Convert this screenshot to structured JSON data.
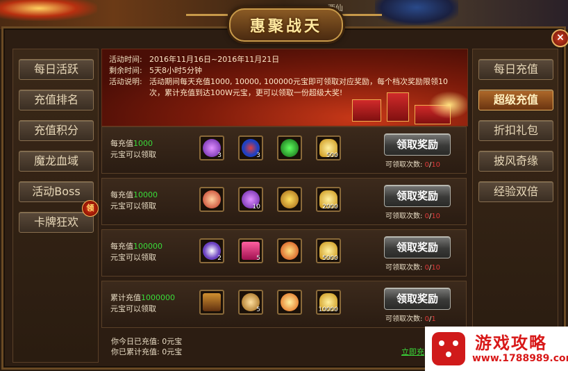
{
  "window": {
    "title": "惠聚战天",
    "top_name": "酉仙",
    "close_label": "×"
  },
  "left_menu": [
    {
      "label": "每日活跃"
    },
    {
      "label": "充值排名"
    },
    {
      "label": "充值积分"
    },
    {
      "label": "魔龙血域"
    },
    {
      "label": "活动Boss"
    },
    {
      "label": "卡牌狂欢"
    }
  ],
  "claim_badge": "领",
  "right_menu": [
    {
      "label": "每日充值",
      "active": false
    },
    {
      "label": "超级充值",
      "active": true
    },
    {
      "label": "折扣礼包",
      "active": false
    },
    {
      "label": "披风奇缘",
      "active": false
    },
    {
      "label": "经验双倍",
      "active": false
    }
  ],
  "banner": {
    "time_label": "活动时间:",
    "time_value": "2016年11月16日~2016年11月21日",
    "remain_label": "剩余时间:",
    "remain_value": "5天8小时5分钟",
    "desc_label": "活动说明:",
    "desc_line1": "活动期间每天充值1000, 10000, 100000元宝即可领取对应奖励，每个档次奖励限领10",
    "desc_line2": "次，累计充值到达100W元宝，更可以领取一份超级大奖!"
  },
  "tiers": [
    {
      "prefix": "每充值",
      "amount": "1000",
      "suffix": "元宝可以领取",
      "items": [
        {
          "icon": "purple-gem-icon",
          "qty": "3"
        },
        {
          "icon": "blue-orb-icon",
          "qty": "3"
        },
        {
          "icon": "green-rune-icon",
          "qty": ""
        },
        {
          "icon": "gold-ingot-icon",
          "qty": "500"
        }
      ],
      "button": "领取奖励",
      "count_label": "可领取次数:",
      "count_used": "0",
      "count_max": "10"
    },
    {
      "prefix": "每充值",
      "amount": "10000",
      "suffix": "元宝可以领取",
      "items": [
        {
          "icon": "feather-fan-icon",
          "qty": ""
        },
        {
          "icon": "purple-gem-icon",
          "qty": "10"
        },
        {
          "icon": "gold-medal-icon",
          "qty": ""
        },
        {
          "icon": "gold-ingot-icon",
          "qty": "2000"
        }
      ],
      "button": "领取奖励",
      "count_label": "可领取次数:",
      "count_used": "0",
      "count_max": "10"
    },
    {
      "prefix": "每充值",
      "amount": "100000",
      "suffix": "元宝可以领取",
      "items": [
        {
          "icon": "star-burst-icon",
          "qty": "2"
        },
        {
          "icon": "gift-box-icon",
          "qty": "5"
        },
        {
          "icon": "fire-orb-icon",
          "qty": ""
        },
        {
          "icon": "gold-ingot-icon",
          "qty": "5000"
        }
      ],
      "button": "领取奖励",
      "count_label": "可领取次数:",
      "count_used": "0",
      "count_max": "10"
    },
    {
      "prefix": "累计充值",
      "amount": "1000000",
      "suffix": "元宝可以领取",
      "items": [
        {
          "icon": "treasure-chest-icon",
          "qty": ""
        },
        {
          "icon": "golden-scroll-icon",
          "qty": "5"
        },
        {
          "icon": "exp-icon",
          "qty": ""
        },
        {
          "icon": "gold-ingot-icon",
          "qty": "10000"
        }
      ],
      "button": "领取奖励",
      "count_label": "可领取次数:",
      "count_used": "0",
      "count_max": "1"
    }
  ],
  "footer": {
    "today_label": "你今日已充值:",
    "today_value": "0元宝",
    "total_label": "你已累计充值:",
    "total_value": "0元宝",
    "recharge_link": "立即充"
  },
  "watermark": {
    "title": "游戏攻略",
    "url": "www.1788989.com"
  },
  "colors": {
    "accent_green": "#3adc3a",
    "count_red": "#e03a3a",
    "active_tab": "#b06a2a"
  }
}
